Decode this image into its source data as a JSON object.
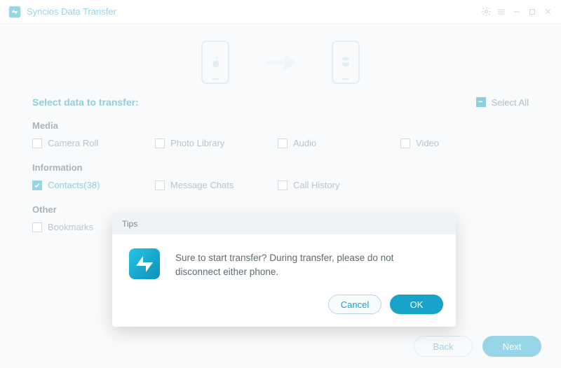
{
  "app": {
    "title": "Syncios Data Transfer"
  },
  "icons": {
    "gear": "gear-icon",
    "menu": "menu-icon",
    "min": "minimize-icon",
    "max": "maximize-icon",
    "close": "close-icon"
  },
  "header": {
    "select_label": "Select data to transfer:",
    "select_all": "Select All",
    "select_all_state": "partial"
  },
  "groups": {
    "media": {
      "label": "Media",
      "items": [
        {
          "key": "camera_roll",
          "label": "Camera Roll",
          "checked": false
        },
        {
          "key": "photo_library",
          "label": "Photo Library",
          "checked": false
        },
        {
          "key": "audio",
          "label": "Audio",
          "checked": false
        },
        {
          "key": "video",
          "label": "Video",
          "checked": false
        }
      ]
    },
    "information": {
      "label": "Information",
      "items": [
        {
          "key": "contacts",
          "label": "Contacts(38)",
          "checked": true
        },
        {
          "key": "message_chats",
          "label": "Message Chats",
          "checked": false
        },
        {
          "key": "call_history",
          "label": "Call History",
          "checked": false
        }
      ]
    },
    "other": {
      "label": "Other",
      "items": [
        {
          "key": "bookmarks",
          "label": "Bookmarks",
          "checked": false
        }
      ]
    }
  },
  "footer": {
    "back": "Back",
    "next": "Next"
  },
  "dialog": {
    "title": "Tips",
    "message": "Sure to start transfer? During transfer, please do not disconnect either phone.",
    "cancel": "Cancel",
    "ok": "OK"
  },
  "colors": {
    "accent": "#1aa3c9"
  }
}
